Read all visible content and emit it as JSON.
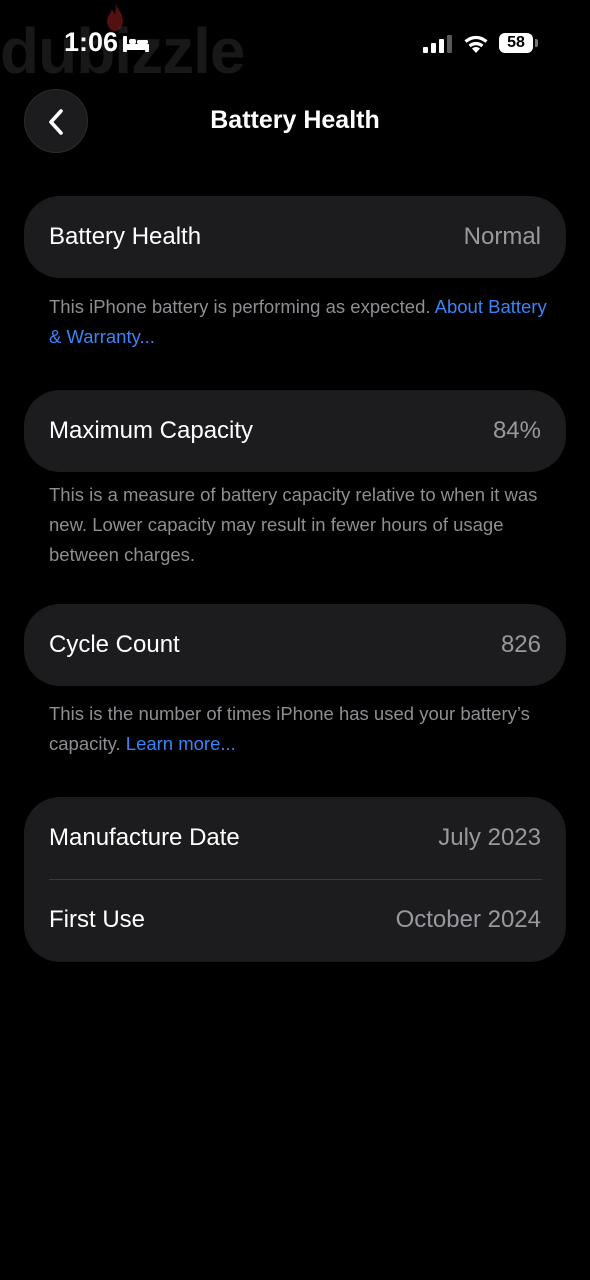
{
  "status_bar": {
    "time": "1:06",
    "battery_level": "58",
    "watermark": "dubizzle"
  },
  "nav": {
    "title": "Battery Health"
  },
  "sections": {
    "battery_health": {
      "label": "Battery Health",
      "value": "Normal",
      "footnote": "This iPhone battery is performing as expected.",
      "footnote_link": "About Battery & Warranty..."
    },
    "maximum_capacity": {
      "label": "Maximum Capacity",
      "value": "84%",
      "footnote": "This is a measure of battery capacity relative to when it was new. Lower capacity may result in fewer hours of usage between charges."
    },
    "cycle_count": {
      "label": "Cycle Count",
      "value": "826",
      "footnote": "This is the number of times iPhone has used your battery’s capacity.",
      "footnote_link": "Learn more..."
    },
    "dates": {
      "manufacture_label": "Manufacture Date",
      "manufacture_value": "July 2023",
      "first_use_label": "First Use",
      "first_use_value": "October 2024"
    }
  },
  "colors": {
    "background": "#000000",
    "card": "#1c1c1e",
    "secondary_text": "#98989f",
    "link": "#3a84f7"
  }
}
